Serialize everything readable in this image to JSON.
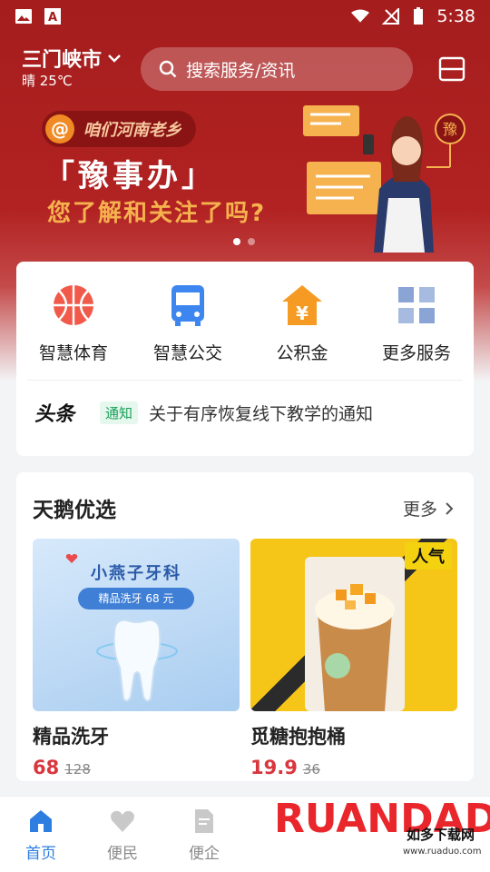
{
  "status_bar": {
    "time": "5:38"
  },
  "header": {
    "city": "三门峡市",
    "weather": "晴 25℃",
    "search_placeholder": "搜索服务/资讯"
  },
  "banner": {
    "tag": "咱们河南老乡",
    "tag_symbol": "@",
    "title": "「豫事办」",
    "subtitle": "您了解和关注了吗?",
    "seal": "豫",
    "slide_count": 2,
    "active_slide": 1
  },
  "services": {
    "items": [
      {
        "label": "智慧体育",
        "icon": "basketball-icon",
        "color": "#f15a4a"
      },
      {
        "label": "智慧公交",
        "icon": "bus-icon",
        "color": "#3d86f0"
      },
      {
        "label": "公积金",
        "icon": "house-fund-icon",
        "color": "#f59a23"
      },
      {
        "label": "更多服务",
        "icon": "grid-icon",
        "color": "#8aa4d6"
      }
    ],
    "news": {
      "source": "头条",
      "badge": "通知",
      "text": "关于有序恢复线下教学的通知"
    }
  },
  "selection": {
    "title": "天鹅优选",
    "more": "更多",
    "products": [
      {
        "name": "精品洗牙",
        "price": "68",
        "original_price": "128",
        "image_title": "小燕子牙科",
        "image_pill": "精品洗牙 68 元"
      },
      {
        "name": "觅糖抱抱桶",
        "price": "19.9",
        "original_price": "36",
        "image_badge": "人气"
      }
    ]
  },
  "bottom_nav": {
    "items": [
      {
        "label": "首页",
        "icon": "home-icon",
        "active": true
      },
      {
        "label": "便民",
        "icon": "heart-icon",
        "active": false
      },
      {
        "label": "便企",
        "icon": "document-icon",
        "active": false
      }
    ]
  },
  "watermark": {
    "brand": "RUANDADO",
    "cn": "如多下载网",
    "url": "www.ruaduo.com"
  },
  "colors": {
    "brand_red": "#a51d1d",
    "accent_blue": "#2e7de1",
    "price_red": "#d9363e",
    "badge_green": "#18a058"
  }
}
